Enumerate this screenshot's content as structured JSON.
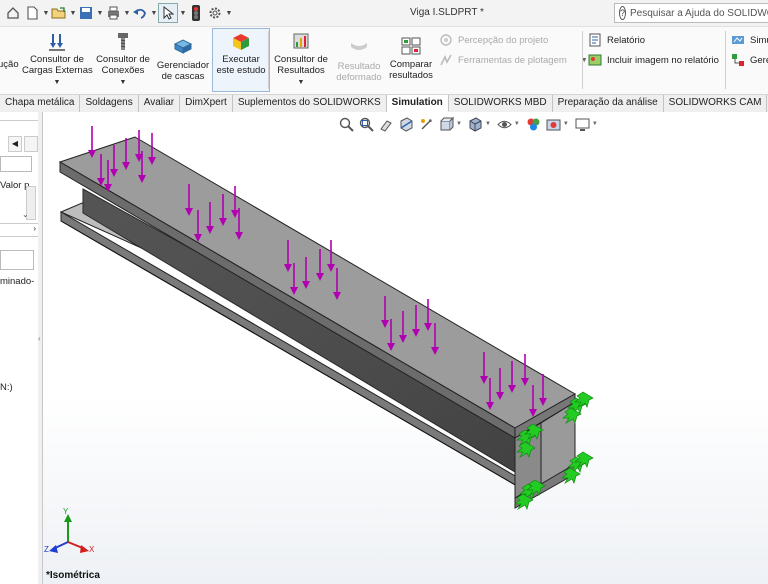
{
  "window": {
    "title": "Viga I.SLDPRT *",
    "help_search_placeholder": "Pesquisar a Ajuda do SOLIDWORKS"
  },
  "quick_access": {
    "icons": [
      "home-icon",
      "new-document-icon",
      "open-icon",
      "save-icon",
      "print-icon",
      "undo-icon",
      "select-icon",
      "traffic-light-icon",
      "options-gear-icon"
    ]
  },
  "ribbon": {
    "items": [
      {
        "label": "ução",
        "icon": "cut-off-icon"
      },
      {
        "label": "Consultor de\nCargas Externas",
        "icon": "external-loads-icon"
      },
      {
        "label": "Consultor de\nConexões",
        "icon": "connections-icon"
      },
      {
        "label": "Gerenciador\nde cascas",
        "icon": "shell-manager-icon"
      },
      {
        "label": "Executar\neste estudo",
        "icon": "run-study-icon"
      },
      {
        "label": "Consultor de\nResultados",
        "icon": "results-advisor-icon"
      },
      {
        "label": "Resultado\ndeformado",
        "icon": "deformed-result-icon",
        "disabled": true
      },
      {
        "label": "Comparar\nresultados",
        "icon": "compare-results-icon"
      }
    ],
    "design_insight": "Percepção do projeto",
    "plot_tools": "Ferramentas de plotagem",
    "report": "Relatório",
    "include_image": "Incluir imagem no relatório",
    "simu_partial": "Simu",
    "gere_partial": "Gere"
  },
  "tabs": [
    {
      "label": "Chapa metálica",
      "active": false
    },
    {
      "label": "Soldagens",
      "active": false
    },
    {
      "label": "Avaliar",
      "active": false
    },
    {
      "label": "DimXpert",
      "active": false
    },
    {
      "label": "Suplementos do SOLIDWORKS",
      "active": false
    },
    {
      "label": "Simulation",
      "active": true
    },
    {
      "label": "SOLIDWORKS MBD",
      "active": false
    },
    {
      "label": "Preparação da análise",
      "active": false
    },
    {
      "label": "SOLIDWORKS CAM",
      "active": false
    }
  ],
  "left_panel": {
    "valor_label": "Valor p",
    "laminado_label": "minado-",
    "n_label": "N:)"
  },
  "viewport": {
    "view_name": "*Isométrica",
    "axes": {
      "x": "X",
      "y": "Y",
      "z": "Z"
    },
    "load_arrow_color": "#b000b0",
    "fixture_color": "#22cc22",
    "beam_color": "#8f8f8f"
  }
}
